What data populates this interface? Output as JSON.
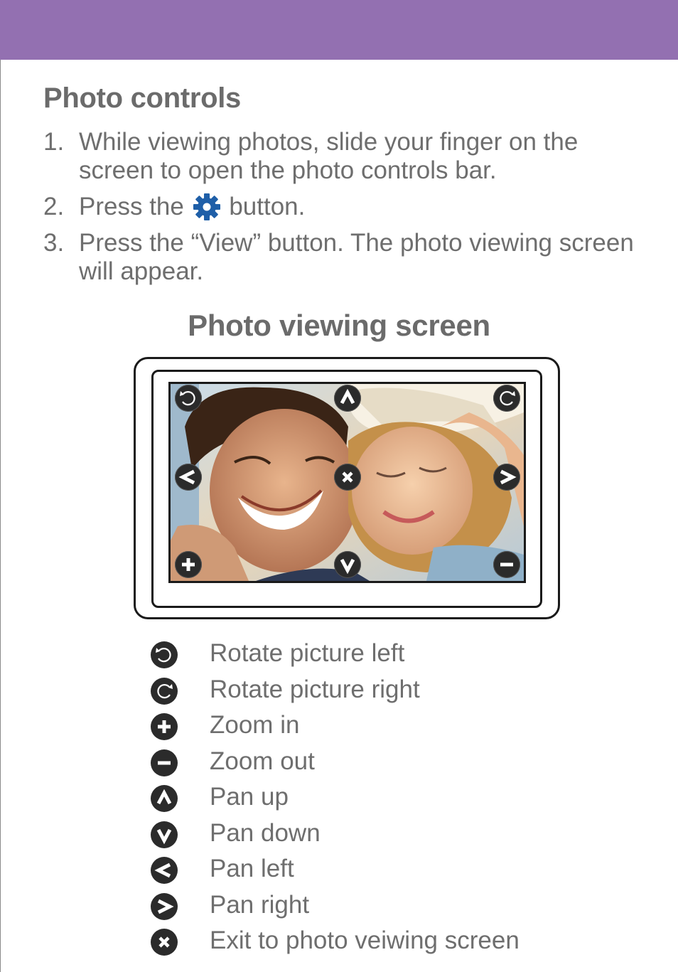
{
  "section_title": "Photo controls",
  "steps": [
    {
      "num": "1.",
      "text": "While viewing photos, slide your finger on the screen to open the photo controls bar."
    },
    {
      "num": "2.",
      "before": "Press the",
      "icon": "gear-icon",
      "after": "button."
    },
    {
      "num": "3.",
      "text": "Press the “View” button.  The photo viewing screen will appear."
    }
  ],
  "screen_title": "Photo viewing screen",
  "photo": {
    "alt": "couple-photo-image"
  },
  "overlay_controls": [
    {
      "name": "rotate-left",
      "icon": "rotate-left-icon"
    },
    {
      "name": "pan-up",
      "icon": "chevron-up-icon"
    },
    {
      "name": "rotate-right",
      "icon": "rotate-right-icon"
    },
    {
      "name": "pan-left",
      "icon": "chevron-left-icon"
    },
    {
      "name": "exit",
      "icon": "close-icon"
    },
    {
      "name": "pan-right",
      "icon": "chevron-right-icon"
    },
    {
      "name": "zoom-in",
      "icon": "plus-icon"
    },
    {
      "name": "pan-down",
      "icon": "chevron-down-icon"
    },
    {
      "name": "zoom-out",
      "icon": "minus-icon"
    }
  ],
  "legend": [
    {
      "icon": "rotate-left-icon",
      "label": "Rotate picture left"
    },
    {
      "icon": "rotate-right-icon",
      "label": "Rotate picture right"
    },
    {
      "icon": "plus-icon",
      "label": "Zoom in"
    },
    {
      "icon": "minus-icon",
      "label": "Zoom out"
    },
    {
      "icon": "chevron-up-icon",
      "label": "Pan up"
    },
    {
      "icon": "chevron-down-icon",
      "label": "Pan down"
    },
    {
      "icon": "chevron-left-icon",
      "label": "Pan left"
    },
    {
      "icon": "chevron-right-icon",
      "label": "Pan right"
    },
    {
      "icon": "close-icon",
      "label": "Exit to photo veiwing screen"
    }
  ],
  "colors": {
    "header": "#9370b1",
    "gear": "#1f5fa8",
    "button": "#2b2b2b"
  }
}
